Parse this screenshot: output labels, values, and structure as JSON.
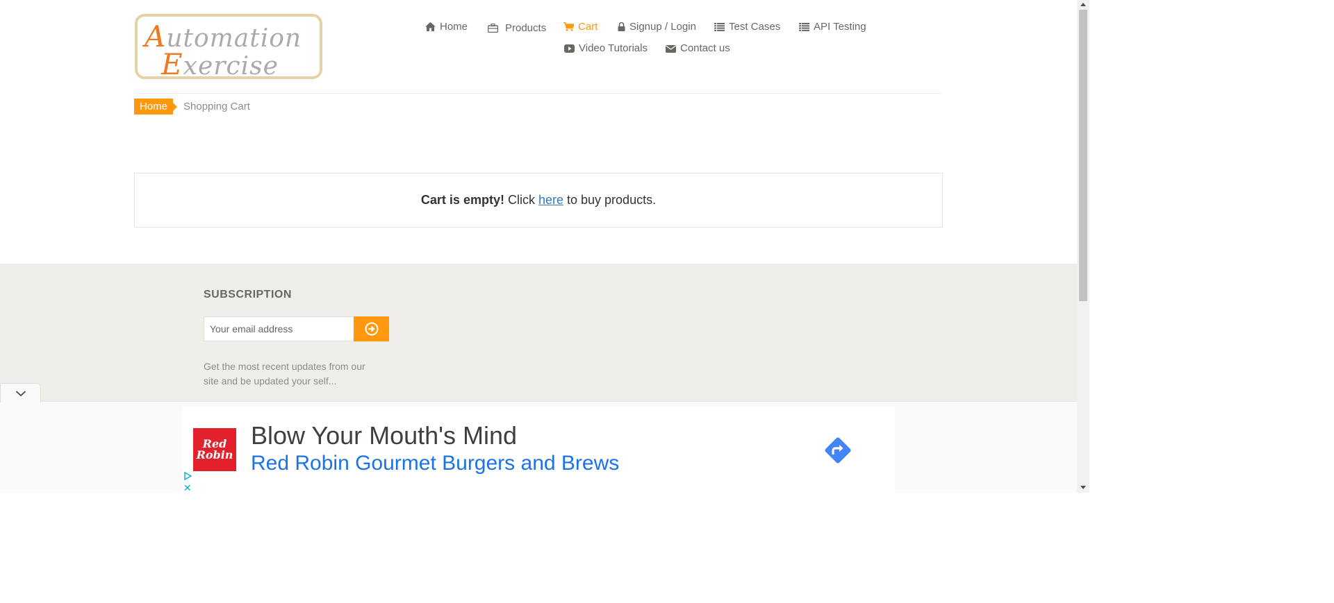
{
  "logo": {
    "line1_cap": "A",
    "line1_rest": "utomation",
    "line2_cap": "E",
    "line2_rest": "xercise"
  },
  "nav": [
    {
      "label": "Home",
      "icon": "home-icon"
    },
    {
      "label": "Products",
      "icon": "briefcase-icon"
    },
    {
      "label": "Cart",
      "icon": "cart-icon",
      "active": true
    },
    {
      "label": "Signup / Login",
      "icon": "lock-icon"
    },
    {
      "label": "Test Cases",
      "icon": "list-icon"
    },
    {
      "label": "API Testing",
      "icon": "list-icon"
    },
    {
      "label": "Video Tutorials",
      "icon": "youtube-icon"
    },
    {
      "label": "Contact us",
      "icon": "envelope-icon"
    }
  ],
  "breadcrumb": {
    "home": "Home",
    "current": "Shopping Cart"
  },
  "cart": {
    "empty_strong": "Cart is empty!",
    "empty_mid": " Click ",
    "link": "here",
    "empty_end": " to buy products."
  },
  "subscription": {
    "title": "SUBSCRIPTION",
    "placeholder": "Your email address",
    "description": "Get the most recent updates from our site and be updated your self..."
  },
  "ad": {
    "brand_line1": "Red",
    "brand_line2": "Robin",
    "headline": "Blow Your Mouth's Mind",
    "subline": "Red Robin Gourmet Burgers and Brews"
  },
  "colors": {
    "accent": "#fe980f",
    "link": "#337ab7",
    "footer_bg": "#efeee8",
    "ad_blue": "#1a73e8",
    "ad_red": "#e1222c"
  }
}
